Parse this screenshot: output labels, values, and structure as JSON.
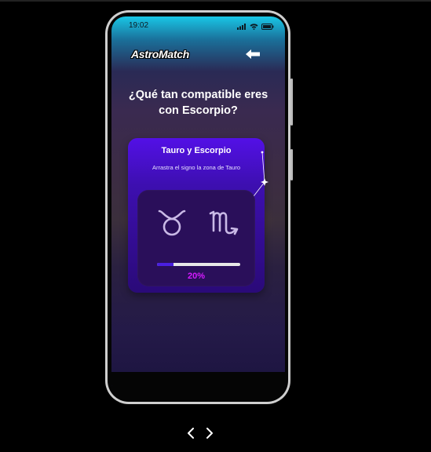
{
  "status": {
    "time": "19:02"
  },
  "app": {
    "logo": "AstroMatch"
  },
  "page": {
    "question_line1": "¿Qué tan compatible eres",
    "question_line2": "con Escorpio?"
  },
  "card": {
    "title": "Tauro y Escorpio",
    "subtitle": "Arrastra el signo la zona de Tauro",
    "signs": [
      {
        "name": "Tauro",
        "icon": "taurus-icon",
        "glyph": "♉"
      },
      {
        "name": "Escorpio",
        "icon": "scorpio-icon",
        "glyph": "♏"
      }
    ],
    "progress": 0.2,
    "progress_text": "20%"
  },
  "colors": {
    "accent": "#4a1fe0",
    "percent": "#d61bff",
    "card_top": "#5310e6"
  }
}
